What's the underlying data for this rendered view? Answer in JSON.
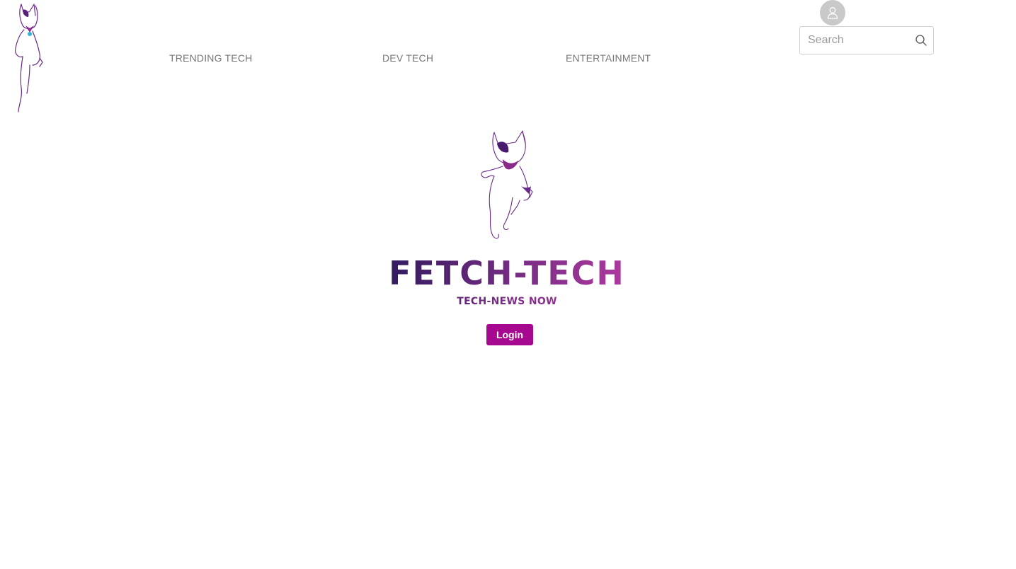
{
  "nav": {
    "items": [
      {
        "label": "TRENDING TECH"
      },
      {
        "label": "DEV TECH"
      },
      {
        "label": "ENTERTAINMENT"
      }
    ]
  },
  "header": {
    "logo_icon": "running-dog-icon",
    "avatar_icon": "user-icon",
    "search": {
      "placeholder": "Search",
      "value": "",
      "icon": "search-icon"
    }
  },
  "hero": {
    "brand_title": "FETCH-TECH",
    "tagline": "TECH-NEWS NOW",
    "login_label": "Login",
    "dog_icon": "running-dog-icon"
  },
  "colors": {
    "accent": "#a6098f",
    "brand_dark": "#2f1a5e",
    "brand_light": "#b03aa0",
    "nav_text": "#777777",
    "avatar_bg": "#c9c9c9"
  }
}
